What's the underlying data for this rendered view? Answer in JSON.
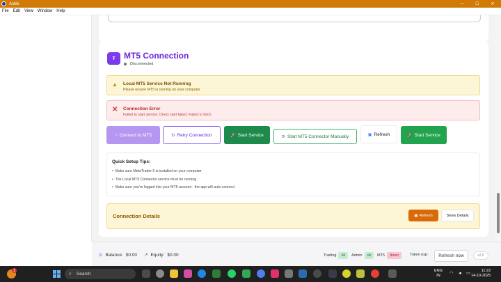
{
  "window": {
    "title": "Aslek",
    "min": "—",
    "max": "☐",
    "close": "✕"
  },
  "menu": [
    "File",
    "Edit",
    "View",
    "Window",
    "Help"
  ],
  "mt5": {
    "icon": "₮",
    "title": "MT5 Connection",
    "status": "Disconnected"
  },
  "alerts": {
    "warn_icon": "▲",
    "warn_title": "Local MT5 Service Not Running",
    "warn_msg": "Please ensure MT5 is running on your computer",
    "err_icon": "✕",
    "err_title": "Connection Error",
    "err_msg": "Failed to start service: Direct start failed: Failed to fetch"
  },
  "buttons": {
    "connect": "Connect to MT5",
    "connect_icon": "○",
    "retry": "Retry Connection",
    "retry_icon": "↻",
    "start_service": "Start Service",
    "start_icon": "🚀",
    "manual": "Start MT5 Connector Manually",
    "manual_icon": "⟳",
    "refresh": "Refresh",
    "refresh_icon": "▣",
    "start_service_2": "Start Service"
  },
  "tips": {
    "heading": "Quick Setup Tips:",
    "items": [
      "Make sure MetaTrader 5 is installed on your computer",
      "The Local MT5 Connector service must be running",
      "Make sure you're logged into your MT5 account - the app will auto-connect"
    ]
  },
  "details": {
    "title": "Connection Details",
    "refresh": "Refresh",
    "refresh_icon": "▣",
    "show": "Show Details"
  },
  "footer": {
    "balance_label": "Balance:",
    "balance_value": "$0.00",
    "equity_label": "Equity:",
    "equity_value": "$0.00",
    "trading_label": "Trading",
    "trading_status": "ok",
    "admin_label": "Admin",
    "admin_status": "ok",
    "mt5_label": "MT5",
    "mt5_status": "down",
    "token_label": "Token exp:",
    "refresh_now": "Refresh now",
    "version": "v2.0"
  },
  "taskbar": {
    "notification_count": "1",
    "search_placeholder": "Search",
    "lang_top": "ENG",
    "lang_bottom": "IN",
    "time": "11:22",
    "date": "14-10-2025"
  },
  "colors": {
    "titlebar": "#d17a06",
    "accent_purple": "#6d28d9",
    "success_green": "#22a34d",
    "warning_bg": "#fdf6d6",
    "error_bg": "#fdecec",
    "orange_button": "#d86a08"
  }
}
